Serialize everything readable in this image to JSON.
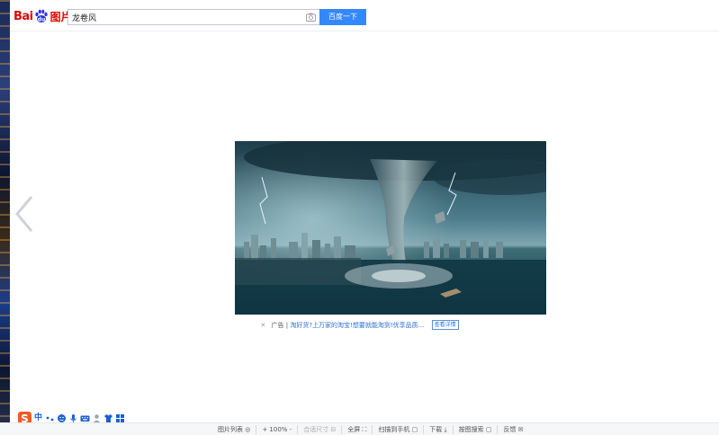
{
  "header": {
    "logo_text": "Bai",
    "logo_suffix": "图片",
    "search_value": "龙卷风",
    "search_button": "百度一下"
  },
  "viewer": {
    "image_alt": "tornado over city by the sea",
    "ad": {
      "label": "广告",
      "link_text": "淘好货?上万家的淘宝!想要就能淘到!优享品质...",
      "detail_button": "查看详情"
    }
  },
  "ime": {
    "zh_label": "中"
  },
  "toolbar": {
    "items": [
      {
        "label": "图片列表 ◎"
      },
      {
        "label": "+ 100% -"
      },
      {
        "label": "合适尺寸 ⊟"
      },
      {
        "label": "全屏 ⛶"
      },
      {
        "label": "扫描到手机 ▢"
      },
      {
        "label": "下载 ⤓"
      },
      {
        "label": "按图搜索 ▢"
      },
      {
        "label": "反馈 ✉"
      }
    ]
  },
  "colors": {
    "accent": "#3388ff",
    "logo_red": "#e10602",
    "logo_blue": "#2932e1"
  }
}
